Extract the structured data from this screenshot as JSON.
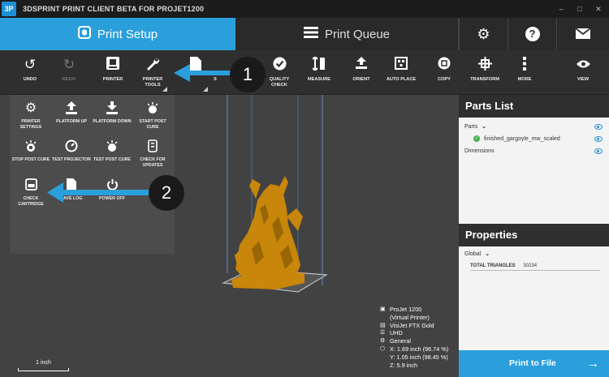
{
  "titlebar": {
    "logo": "3P",
    "title": "3DSPRINT PRINT CLIENT BETA FOR PROJET1200",
    "minimize": "–",
    "maximize": "□",
    "close": "✕"
  },
  "tabs": {
    "setup": "Print Setup",
    "queue": "Print Queue"
  },
  "toolbar": [
    {
      "label": "UNDO",
      "icon": "undo-icon"
    },
    {
      "label": "REDO",
      "icon": "redo-icon"
    },
    {
      "label": "PRINTER",
      "icon": "printer-icon"
    },
    {
      "label": "PRINTER TOOLS",
      "icon": "wrench-icon"
    },
    {
      "label": "S",
      "icon": "file-icon"
    },
    {
      "label": "QUALITY CHECK",
      "icon": "check-icon"
    },
    {
      "label": "MEASURE",
      "icon": "measure-icon"
    },
    {
      "label": "ORIENT",
      "icon": "orient-icon"
    },
    {
      "label": "AUTO PLACE",
      "icon": "autoplace-icon"
    },
    {
      "label": "COPY",
      "icon": "copy-icon"
    },
    {
      "label": "TRANSFORM",
      "icon": "transform-icon"
    },
    {
      "label": "MORE",
      "icon": "more-icon"
    },
    {
      "label": "VIEW",
      "icon": "eye-icon"
    }
  ],
  "printer_tools": [
    {
      "label": "PRINTER SETTINGS",
      "icon": "gear-icon"
    },
    {
      "label": "PLATFORM UP",
      "icon": "platform-up-icon"
    },
    {
      "label": "PLATFORM DOWN",
      "icon": "platform-down-icon"
    },
    {
      "label": "START POST CURE",
      "icon": "cure-icon"
    },
    {
      "label": "STOP POST CURE",
      "icon": "stop-cure-icon"
    },
    {
      "label": "TEST PROJECTOR",
      "icon": "projector-icon"
    },
    {
      "label": "TEST POST CURE",
      "icon": "test-cure-icon"
    },
    {
      "label": "CHECK FOR UPDATES",
      "icon": "update-icon"
    },
    {
      "label": "CHECK CARTRIDGE",
      "icon": "cartridge-icon"
    },
    {
      "label": "SAVE LOG",
      "icon": "save-log-icon"
    },
    {
      "label": "POWER OFF",
      "icon": "power-icon"
    }
  ],
  "callouts": [
    "1",
    "2"
  ],
  "parts_list": {
    "header": "Parts List",
    "parts_label": "Parts",
    "part_name": "finished_gargoyle_mw_scaled",
    "dimensions": "Dimensions"
  },
  "properties": {
    "header": "Properties",
    "global_label": "Global",
    "total_triangles_label": "TOTAL TRIANGLES",
    "total_triangles_value": "30234"
  },
  "print_button": "Print to File",
  "info": {
    "printer": "ProJet 1200",
    "printer_sub": "(Virtual Printer)",
    "material": "VisiJet FTX Gold",
    "mode": "UHD",
    "profile": "General",
    "x": "X:  1.69 inch (98.74 %)",
    "y": "Y:  1.05 inch (98.45 %)",
    "z": "Z:  5.9 inch"
  },
  "scale_label": "1 inch",
  "colors": {
    "accent": "#2a9fdc",
    "model": "#c8860a"
  }
}
